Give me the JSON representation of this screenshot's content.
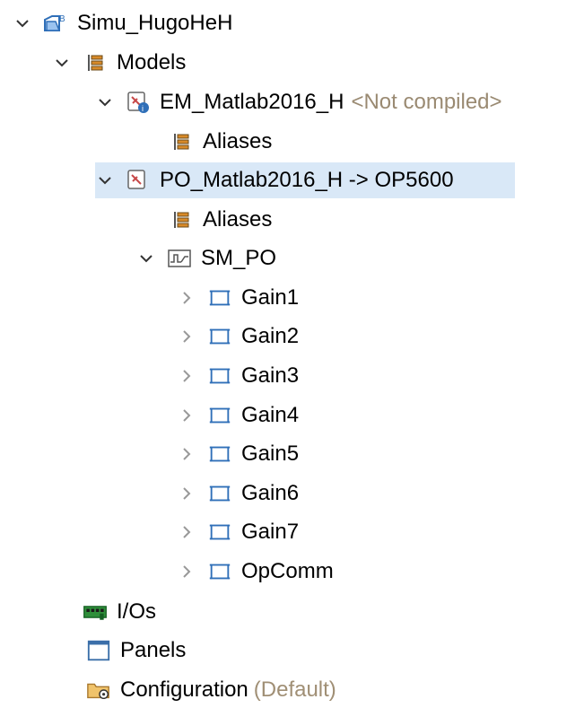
{
  "tree": {
    "root": {
      "label": "Simu_HugoHeH",
      "icon": "project-icon",
      "expanded": true
    },
    "models": {
      "label": "Models",
      "icon": "folder-grid-icon",
      "expanded": true
    },
    "em_model": {
      "label": "EM_Matlab2016_H",
      "status": "<Not compiled>",
      "icon": "model-info-icon",
      "expanded": true
    },
    "em_aliases": {
      "label": "Aliases",
      "icon": "folder-grid-icon"
    },
    "po_model": {
      "label": "PO_Matlab2016_H -> OP5600",
      "icon": "model-icon",
      "expanded": true,
      "selected": true
    },
    "po_aliases": {
      "label": "Aliases",
      "icon": "folder-grid-icon"
    },
    "sm_po": {
      "label": "SM_PO",
      "icon": "subsystem-icon",
      "expanded": true
    },
    "children": [
      {
        "label": "Gain1",
        "icon": "block-icon",
        "expanded": false
      },
      {
        "label": "Gain2",
        "icon": "block-icon",
        "expanded": false
      },
      {
        "label": "Gain3",
        "icon": "block-icon",
        "expanded": false
      },
      {
        "label": "Gain4",
        "icon": "block-icon",
        "expanded": false
      },
      {
        "label": "Gain5",
        "icon": "block-icon",
        "expanded": false
      },
      {
        "label": "Gain6",
        "icon": "block-icon",
        "expanded": false
      },
      {
        "label": "Gain7",
        "icon": "block-icon",
        "expanded": false
      },
      {
        "label": "OpComm",
        "icon": "block-icon",
        "expanded": false
      }
    ],
    "ios": {
      "label": "I/Os",
      "icon": "io-board-icon"
    },
    "panels": {
      "label": "Panels",
      "icon": "panel-window-icon"
    },
    "configuration": {
      "label": "Configuration",
      "suffix": "(Default)",
      "icon": "configuration-folder-icon"
    }
  },
  "colors": {
    "selection": "#d9e8f7",
    "suffix_text": "#9a8a72",
    "icon_blue": "#2f6fb8",
    "icon_orange": "#d88a28"
  }
}
